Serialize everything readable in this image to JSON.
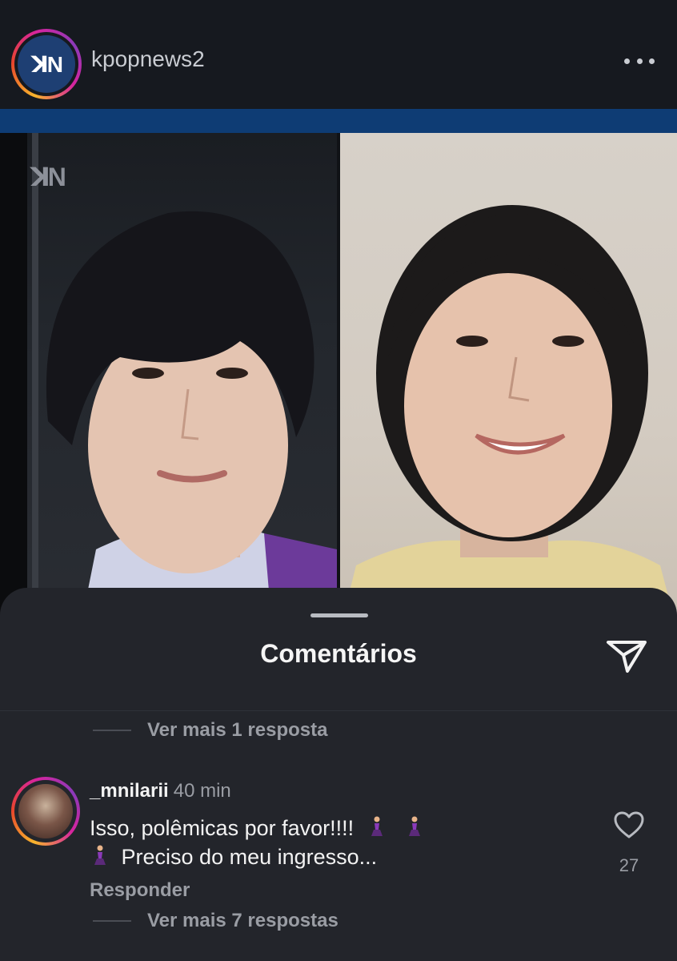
{
  "post": {
    "username": "kpopnews2",
    "avatar_logo": "ꓘN",
    "watermark": "ꓘN"
  },
  "sheet": {
    "title": "Comentários",
    "view_more_top": "Ver mais 1 resposta",
    "comment": {
      "username": "_mnilarii",
      "time": "40 min",
      "text_line1": "Isso, polêmicas por favor!!!!",
      "text_line2": "Preciso do meu ingresso...",
      "like_count": "27",
      "reply_label": "Responder"
    },
    "view_more_bottom": "Ver mais 7 respostas"
  },
  "icons": {
    "more": "more-horizontal-icon",
    "share": "paper-plane-icon",
    "like": "heart-icon",
    "emoji": "person-kneeling-icon"
  },
  "colors": {
    "header_bg": "#16191f",
    "sheet_bg": "#23252b",
    "muted_text": "#9a9da4",
    "band": "#0e3c74"
  }
}
